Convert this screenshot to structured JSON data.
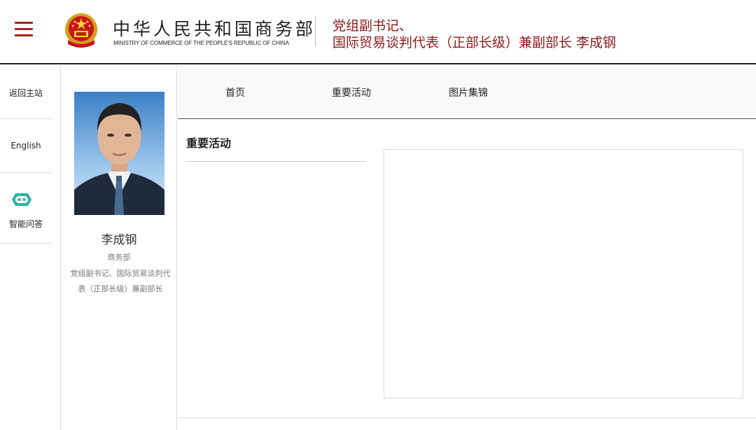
{
  "header": {
    "ministry_cn": "中华人民共和国商务部",
    "ministry_en": "MINISTRY OF COMMERCE OF THE PEOPLE'S REPUBLIC OF CHINA",
    "title_line1": "党组副书记、",
    "title_line2": "国际贸易谈判代表（正部长级）兼副部长 李成钢"
  },
  "tools": {
    "home": "返回主站",
    "english": "English",
    "qa": "智能问答"
  },
  "profile": {
    "name": "李成钢",
    "org": "商务部",
    "position": "党组副书记、国际贸易谈判代表（正部长级）兼副部长"
  },
  "nav": {
    "items": [
      "首页",
      "重要活动",
      "图片集锦"
    ]
  },
  "section": {
    "title": "重要活动"
  },
  "colors": {
    "accent_red": "#8b1a1a",
    "menu_red": "#a51d1d",
    "bot_teal": "#2bb3a8"
  }
}
